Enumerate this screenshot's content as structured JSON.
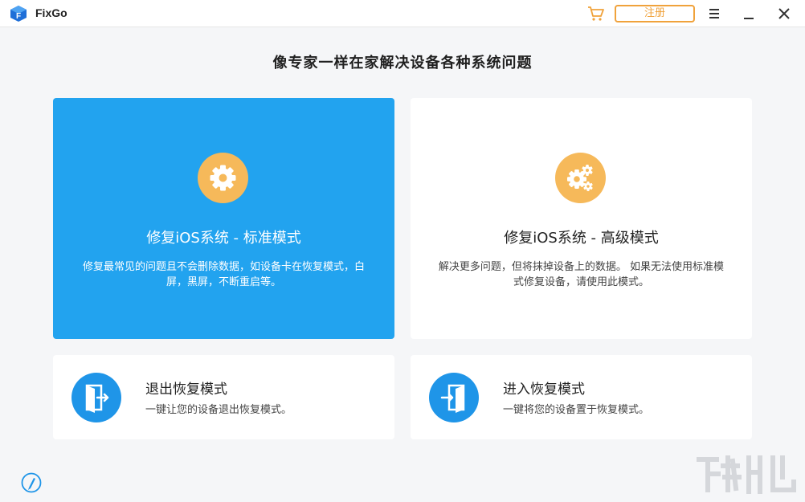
{
  "app": {
    "title": "FixGo",
    "logo_icon": "fixgo-logo-icon",
    "accent_color": "#22a3ef",
    "orange_color": "#f0a23b"
  },
  "titlebar": {
    "cart_icon": "cart-icon",
    "register_label": "注册",
    "menu_icon": "hamburger-menu-icon",
    "minimize_icon": "minimize-icon",
    "close_icon": "close-icon"
  },
  "main": {
    "heading": "像专家一样在家解决设备各种系统问题",
    "modes": [
      {
        "title": "修复iOS系统 - 标准模式",
        "description": "修复最常见的问题且不会删除数据，如设备卡在恢复模式，白屏，黑屏，不断重启等。",
        "icon": "gear-icon",
        "selected": true
      },
      {
        "title": "修复iOS系统 - 高级模式",
        "description": "解决更多问题，但将抹掉设备上的数据。 如果无法使用标准模式修复设备，请使用此模式。",
        "icon": "gears-icon",
        "selected": false
      }
    ],
    "recovery": [
      {
        "title": "退出恢复模式",
        "description": "一键让您的设备退出恢复模式。",
        "icon": "exit-door-icon"
      },
      {
        "title": "进入恢复模式",
        "description": "一键将您的设备置于恢复模式。",
        "icon": "enter-door-icon"
      }
    ]
  },
  "footer": {
    "help_icon": "feedback-icon"
  }
}
